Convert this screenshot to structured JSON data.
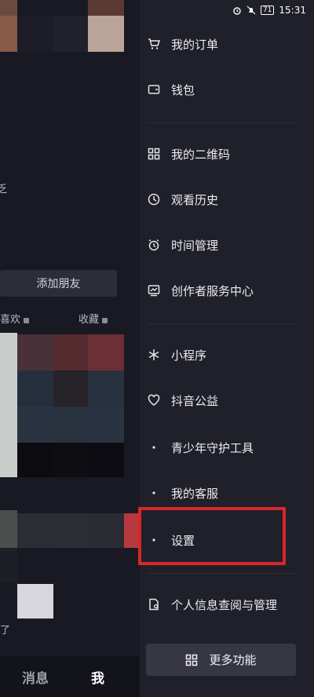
{
  "status_bar": {
    "time": "15:31",
    "battery": "71"
  },
  "profile_background": {
    "add_friend_label": "添加朋友",
    "tab_likes": "喜欢",
    "tab_favorites": "收藏",
    "partial_text_a": "乏",
    "partial_text_b": "了",
    "bottom_nav": {
      "messages": "消息",
      "me": "我"
    }
  },
  "drawer": {
    "items": [
      {
        "label": "我的订单",
        "icon": "cart-icon"
      },
      {
        "label": "钱包",
        "icon": "wallet-icon"
      },
      {
        "label": "我的二维码",
        "icon": "qr-code-icon"
      },
      {
        "label": "观看历史",
        "icon": "clock-icon"
      },
      {
        "label": "时间管理",
        "icon": "alarm-icon"
      },
      {
        "label": "创作者服务中心",
        "icon": "chart-icon"
      },
      {
        "label": "小程序",
        "icon": "asterisk-icon"
      },
      {
        "label": "抖音公益",
        "icon": "heart-hands-icon"
      },
      {
        "label": "青少年守护工具",
        "icon": "shield-icon"
      },
      {
        "label": "我的客服",
        "icon": "headset-icon"
      },
      {
        "label": "设置",
        "icon": "gear-icon"
      },
      {
        "label": "个人信息查阅与管理",
        "icon": "document-icon"
      }
    ],
    "more_button_label": "更多功能",
    "highlight_color": "#d8262b"
  }
}
